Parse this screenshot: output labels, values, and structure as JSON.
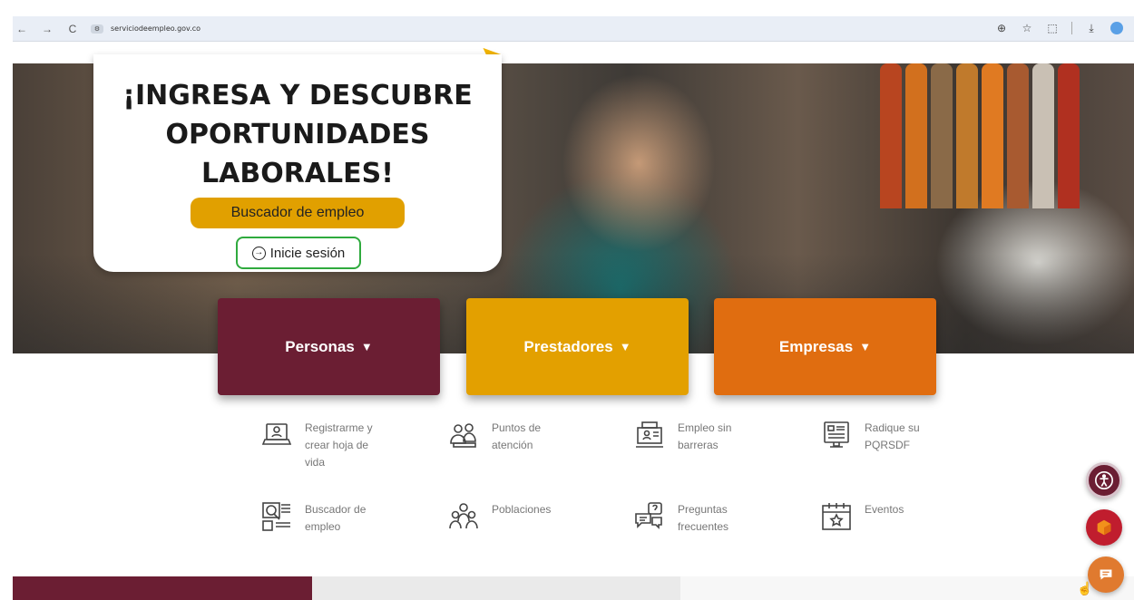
{
  "browser": {
    "url": "serviciodeempleo.gov.co",
    "nav": {
      "back": "←",
      "forward": "→",
      "reload": "C"
    },
    "tools": {
      "zoom": "⊕",
      "star": "☆",
      "extensions": "⬚",
      "download": "⤓"
    }
  },
  "hero": {
    "title_lines": [
      "¡INGRESA Y DESCUBRE",
      "OPORTUNIDADES",
      "LABORALES!"
    ],
    "search_button": "Buscador de empleo",
    "login_button": "Inicie sesión",
    "login_icon": "→"
  },
  "categories": [
    {
      "label": "Personas",
      "color": "#6b1e33"
    },
    {
      "label": "Prestadores",
      "color": "#e3a000"
    },
    {
      "label": "Empresas",
      "color": "#e06d10"
    }
  ],
  "quick_links": [
    {
      "label": "Registrarme y crear hoja de vida",
      "icon": "cv-laptop-icon"
    },
    {
      "label": "Puntos de atención",
      "icon": "people-service-icon"
    },
    {
      "label": "Empleo sin barreras",
      "icon": "accessible-job-icon"
    },
    {
      "label": "Radique su PQRSDF",
      "icon": "document-submit-icon"
    },
    {
      "label": "Buscador de empleo",
      "icon": "job-search-icon"
    },
    {
      "label": "Poblaciones",
      "icon": "population-group-icon"
    },
    {
      "label": "Preguntas frecuentes",
      "icon": "faq-chat-icon"
    },
    {
      "label": "Eventos",
      "icon": "calendar-star-icon"
    }
  ],
  "floating": {
    "accessibility_color": "#6b1e33",
    "app_color": "#c01d2e",
    "chat_color": "#e07a2f"
  }
}
